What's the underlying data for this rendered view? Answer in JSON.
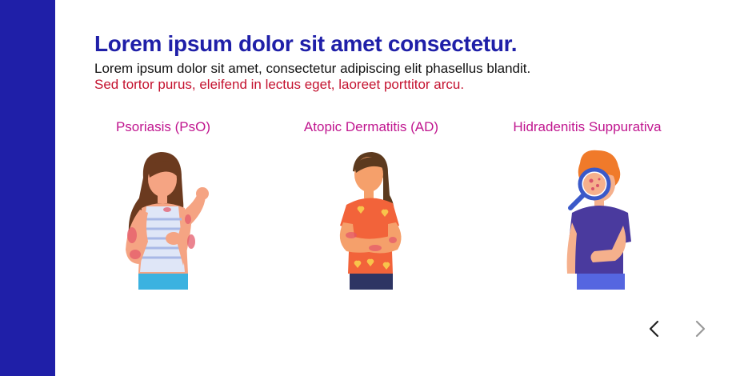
{
  "slide": {
    "title": "Lorem ipsum dolor sit amet consectetur.",
    "subtitle_line1": "Lorem ipsum dolor sit amet, consectetur adipiscing elit phasellus blandit.",
    "subtitle_line2": "Sed tortor purus, eleifend in lectus eget, laoreet porttitor arcu."
  },
  "conditions": [
    {
      "label": "Psoriasis (PsO)",
      "icon": "woman-with-psoriasis-illustration"
    },
    {
      "label": "Atopic Dermatitis (AD)",
      "icon": "woman-scratching-arm-illustration"
    },
    {
      "label": "Hidradenitis Suppurativa",
      "icon": "boy-with-magnifier-illustration"
    }
  ],
  "navigation": {
    "prev_icon": "chevron-left-icon",
    "next_icon": "chevron-right-icon"
  },
  "colors": {
    "sidebar": "#1f1fa8",
    "title": "#1f1fa8",
    "subtitle_accent": "#c4122f",
    "condition_label": "#c0168f",
    "nav_active": "#222222",
    "nav_inactive": "#999999"
  }
}
